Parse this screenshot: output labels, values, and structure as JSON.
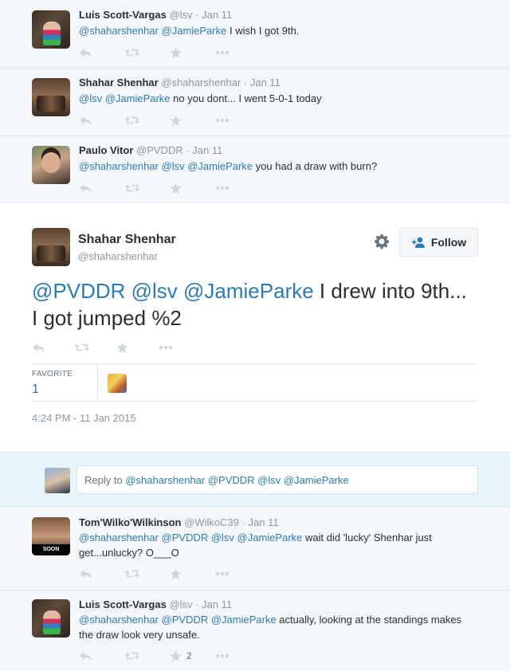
{
  "tweets_before": [
    {
      "name": "Luis Scott-Vargas",
      "handle": "@lsv",
      "time": "Jan 11",
      "mentions": "@shaharshenhar @JamieParke",
      "text": " I wish I got 9th.",
      "fav_count": ""
    },
    {
      "name": "Shahar Shenhar",
      "handle": "@shaharshenhar",
      "time": "Jan 11",
      "mentions": "@lsv @JamieParke",
      "text": " no you dont... I went 5-0-1 today",
      "fav_count": ""
    },
    {
      "name": "Paulo Vitor",
      "handle": "@PVDDR",
      "time": "Jan 11",
      "mentions": "@shaharshenhar @lsv @JamieParke",
      "text": " you had a draw with burn?",
      "fav_count": ""
    }
  ],
  "focused": {
    "name": "Shahar Shenhar",
    "handle": "@shaharshenhar",
    "follow_label": "Follow",
    "mentions": "@PVDDR @lsv @JamieParke",
    "text": " I drew into 9th... I got jumped %2",
    "favorite_label": "FAVORITE",
    "favorite_count": "1",
    "timestamp": "4:24 PM - 11 Jan 2015"
  },
  "reply": {
    "prefix": "Reply to ",
    "mentions": "@shaharshenhar @PVDDR @lsv @JamieParke"
  },
  "tweets_after": [
    {
      "name": "Tom'Wilko'Wilkinson",
      "handle": "@WilkoC39",
      "time": "Jan 11",
      "mentions": "@shaharshenhar @PVDDR @lsv @JamieParke",
      "text": " wait did 'lucky' Shenhar just get...unlucky? O___O",
      "avatar_badge": "SOON",
      "fav_count": ""
    },
    {
      "name": "Luis Scott-Vargas",
      "handle": "@lsv",
      "time": "Jan 11",
      "mentions": "@shaharshenhar @PVDDR @JamieParke",
      "text": " actually, looking at the standings makes the draw look very unsafe.",
      "fav_count": "2"
    }
  ],
  "icons": [
    "reply-icon",
    "retweet-icon",
    "favorite-icon",
    "more-icon",
    "gear-icon",
    "follow-user-icon"
  ],
  "colors": {
    "link": "#2b7bb9",
    "meta": "#8899a6",
    "icon": "#ccd6dd",
    "reply_bg": "#e8f4fb"
  }
}
